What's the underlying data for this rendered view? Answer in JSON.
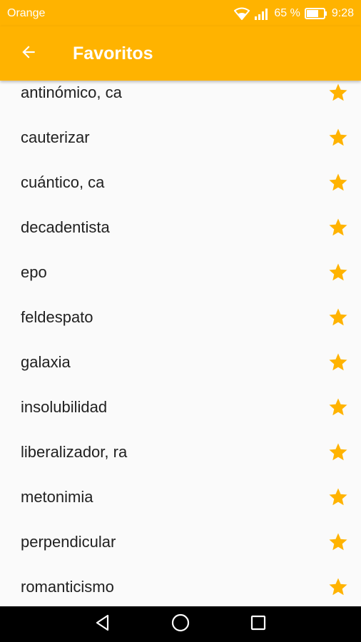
{
  "status_bar": {
    "carrier": "Orange",
    "battery": "65 %",
    "time": "9:28"
  },
  "app_bar": {
    "title": "Favoritos",
    "back_icon": "arrow-back-icon"
  },
  "colors": {
    "accent": "#ffb300",
    "star": "#ffb300",
    "text": "#212121",
    "background": "#fafafa"
  },
  "favorites": [
    {
      "word": "antinómico, ca",
      "favorite": true
    },
    {
      "word": "cauterizar",
      "favorite": true
    },
    {
      "word": "cuántico, ca",
      "favorite": true
    },
    {
      "word": "decadentista",
      "favorite": true
    },
    {
      "word": "epo",
      "favorite": true
    },
    {
      "word": "feldespato",
      "favorite": true
    },
    {
      "word": "galaxia",
      "favorite": true
    },
    {
      "word": "insolubilidad",
      "favorite": true
    },
    {
      "word": "liberalizador, ra",
      "favorite": true
    },
    {
      "word": "metonimia",
      "favorite": true
    },
    {
      "word": "perpendicular",
      "favorite": true
    },
    {
      "word": "romanticismo",
      "favorite": true
    }
  ],
  "nav_bar": {
    "icons": [
      "back-triangle-icon",
      "home-circle-icon",
      "recents-square-icon"
    ]
  }
}
